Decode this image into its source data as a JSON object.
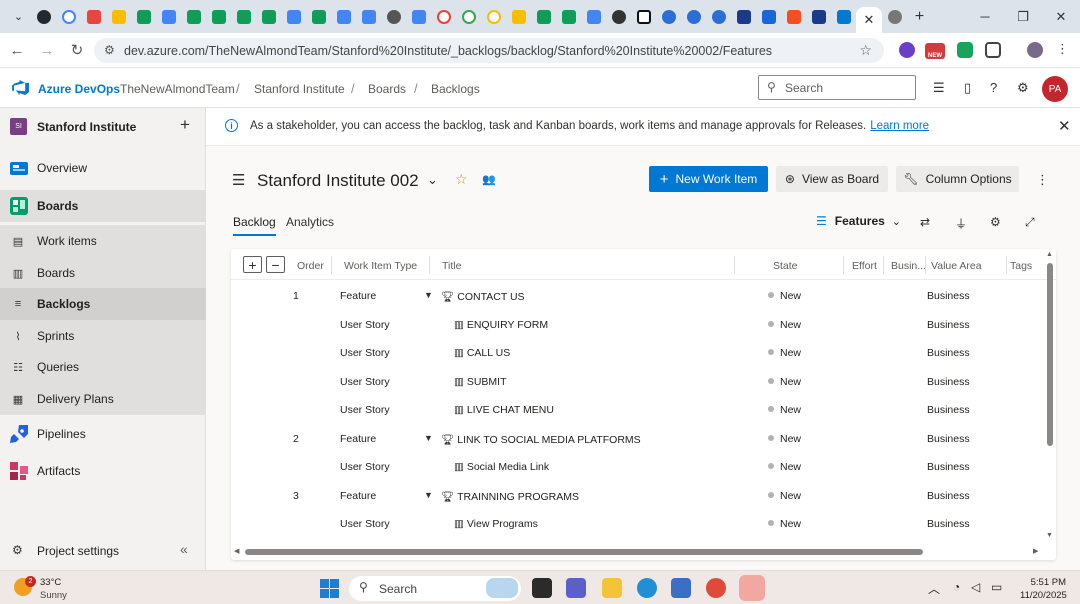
{
  "browser": {
    "url": "dev.azure.com/TheNewAlmondTeam/Stanford%20Institute/_backlogs/backlog/Stanford%20Institute%20002/Features",
    "new_badge": "NEW"
  },
  "header": {
    "product": "Azure DevOps",
    "breadcrumbs": [
      "TheNewAlmondTeam",
      "Stanford Institute",
      "Boards",
      "Backlogs"
    ],
    "search_placeholder": "Search",
    "avatar_initials": "PA"
  },
  "sidebar": {
    "project_badge": "SI",
    "project_name": "Stanford Institute",
    "items": [
      {
        "label": "Overview"
      },
      {
        "label": "Boards"
      },
      {
        "label": "Work items"
      },
      {
        "label": "Boards"
      },
      {
        "label": "Backlogs"
      },
      {
        "label": "Sprints"
      },
      {
        "label": "Queries"
      },
      {
        "label": "Delivery Plans"
      },
      {
        "label": "Pipelines"
      },
      {
        "label": "Artifacts"
      }
    ],
    "settings_label": "Project settings"
  },
  "banner": {
    "message": "As a stakeholder, you can access the backlog, task and Kanban boards, work items and manage approvals for Releases.",
    "link": "Learn more"
  },
  "page": {
    "title": "Stanford Institute 002",
    "new_work_item": "New Work Item",
    "view_as_board": "View as Board",
    "column_options": "Column Options",
    "tabs": [
      "Backlog",
      "Analytics"
    ],
    "level": "Features"
  },
  "grid": {
    "columns": [
      "Order",
      "Work Item Type",
      "Title",
      "State",
      "Effort",
      "Busin...",
      "Value Area",
      "Tags"
    ],
    "rows": [
      {
        "order": "1",
        "type": "Feature",
        "title": "CONTACT US",
        "state": "New",
        "value_area": "Business",
        "kind": "feature"
      },
      {
        "order": "",
        "type": "User Story",
        "title": "ENQUIRY FORM",
        "state": "New",
        "value_area": "Business",
        "kind": "story"
      },
      {
        "order": "",
        "type": "User Story",
        "title": "CALL US",
        "state": "New",
        "value_area": "Business",
        "kind": "story"
      },
      {
        "order": "",
        "type": "User Story",
        "title": "SUBMIT",
        "state": "New",
        "value_area": "Business",
        "kind": "story"
      },
      {
        "order": "",
        "type": "User Story",
        "title": "LIVE CHAT MENU",
        "state": "New",
        "value_area": "Business",
        "kind": "story"
      },
      {
        "order": "2",
        "type": "Feature",
        "title": "LINK TO SOCIAL MEDIA PLATFORMS",
        "state": "New",
        "value_area": "Business",
        "kind": "feature"
      },
      {
        "order": "",
        "type": "User Story",
        "title": "Social Media Link",
        "state": "New",
        "value_area": "Business",
        "kind": "story"
      },
      {
        "order": "3",
        "type": "Feature",
        "title": "TRAINNING PROGRAMS",
        "state": "New",
        "value_area": "Business",
        "kind": "feature"
      },
      {
        "order": "",
        "type": "User Story",
        "title": "View Programs",
        "state": "New",
        "value_area": "Business",
        "kind": "story"
      }
    ]
  },
  "taskbar": {
    "temp": "33°C",
    "condition": "Sunny",
    "weather_badge": "2",
    "search": "Search",
    "time": "5:51 PM",
    "date": "11/20/2025"
  },
  "colors": {
    "accent": "#0078d4",
    "feature_icon": "#773b93",
    "story_icon": "#009ccc",
    "state_new": "#b2b2b2"
  }
}
